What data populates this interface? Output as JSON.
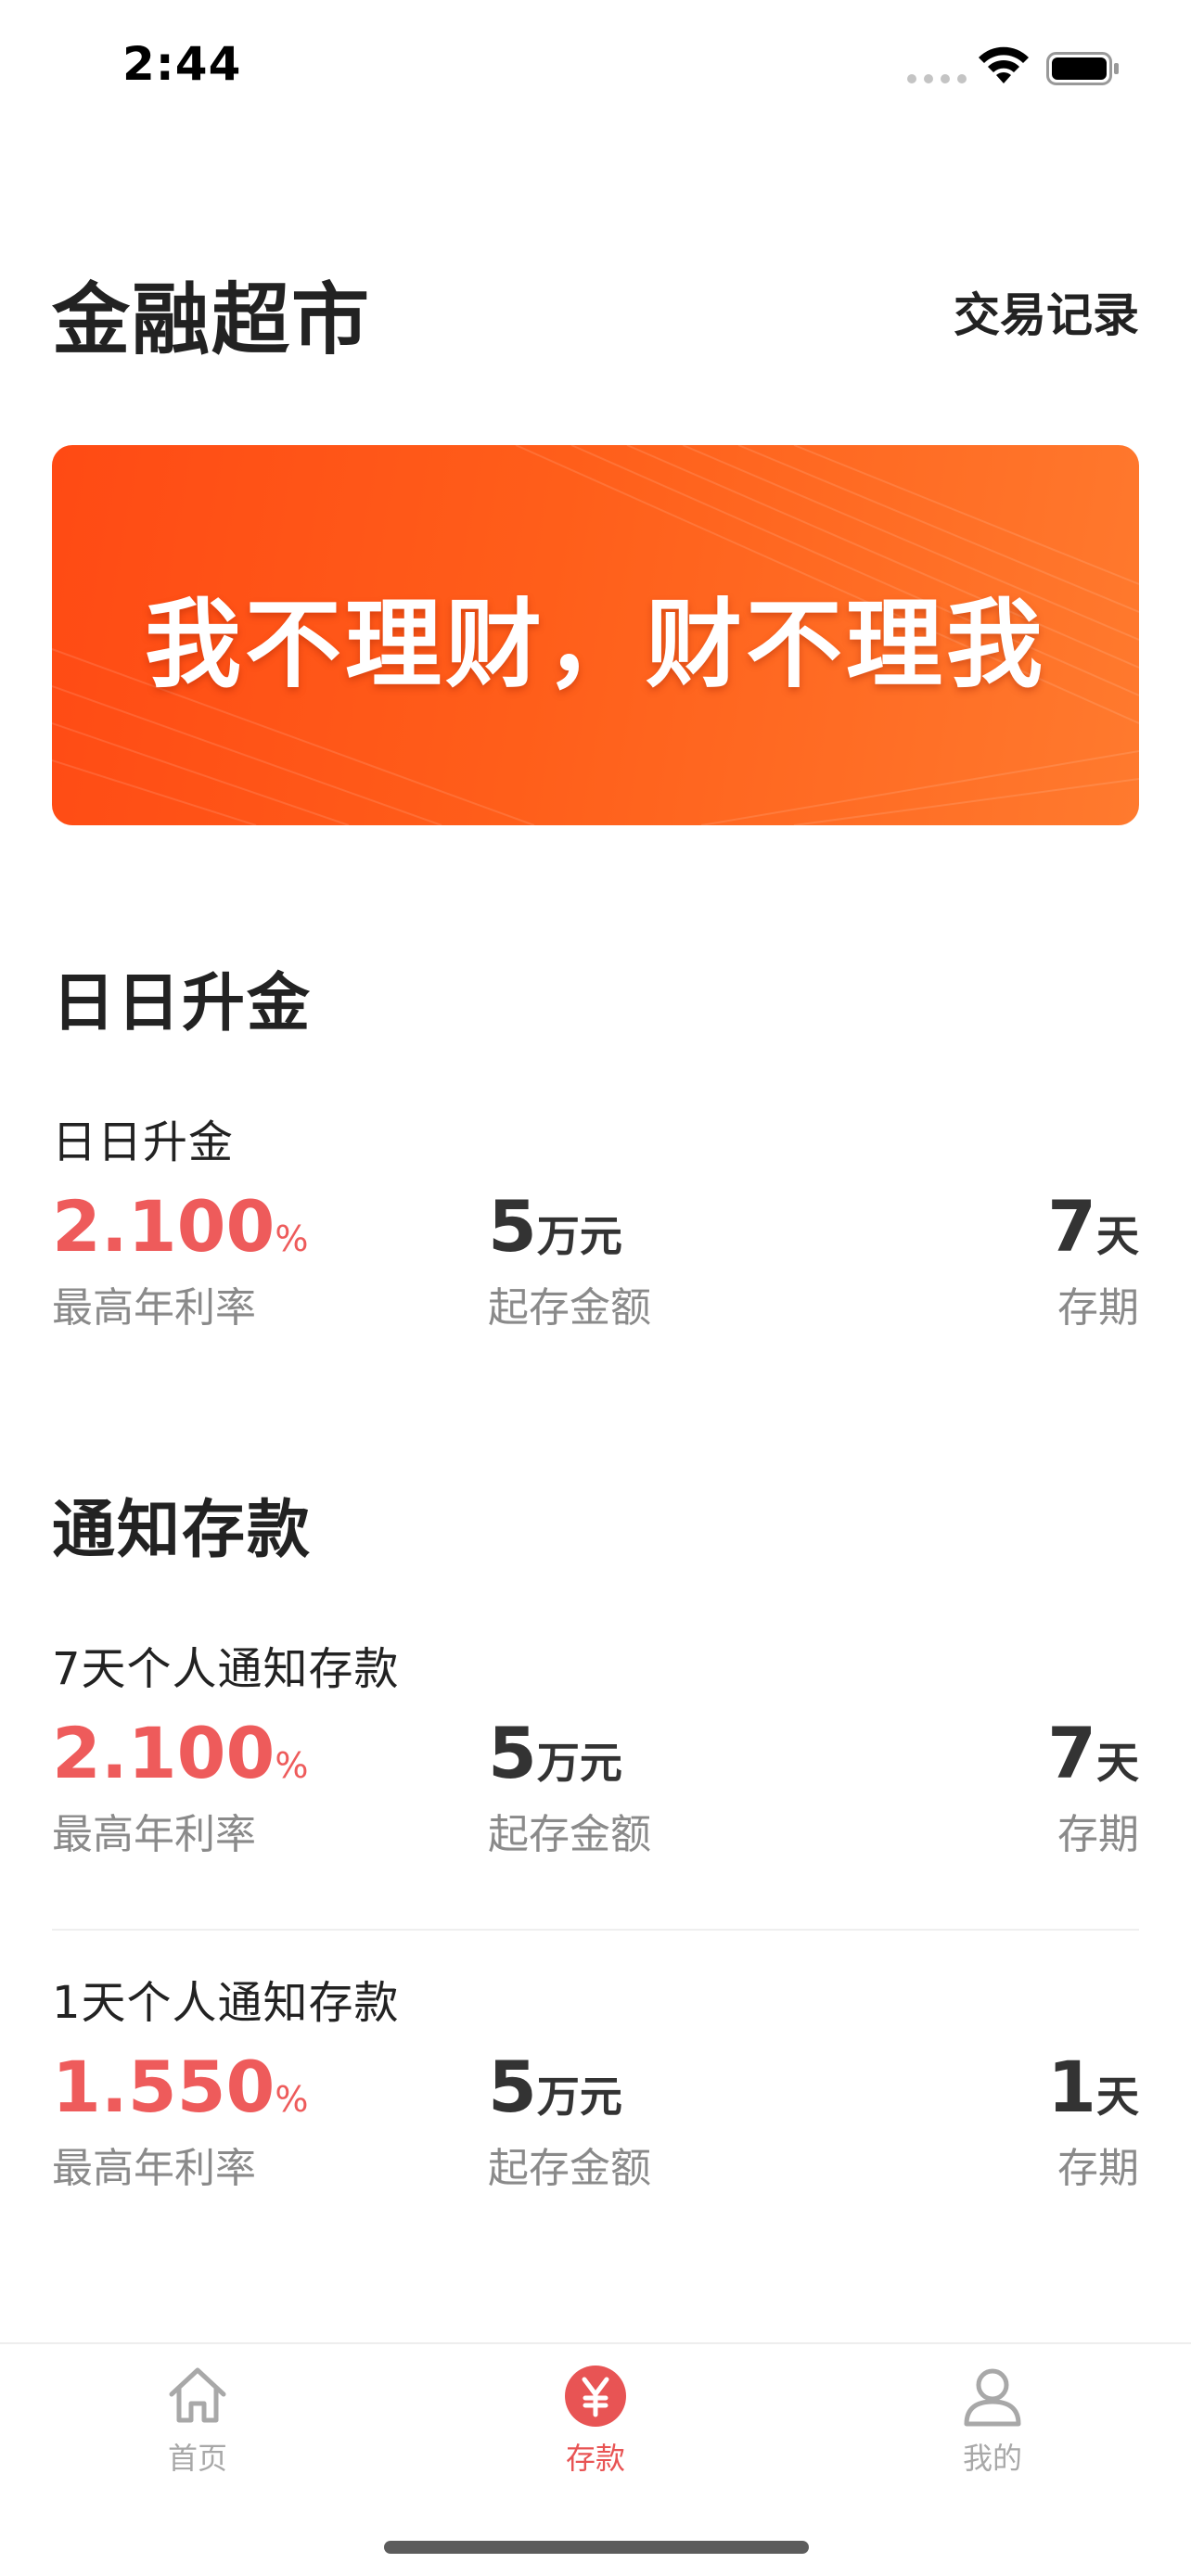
{
  "status_bar": {
    "time": "2:44"
  },
  "header": {
    "title": "金融超市",
    "transaction_link": "交易记录"
  },
  "banner": {
    "text": "我不理财，财不理我"
  },
  "sections": [
    {
      "title": "日日升金",
      "products": [
        {
          "name": "日日升金",
          "rate": "2.100",
          "rate_unit": "%",
          "rate_label": "最高年利率",
          "amount": "5",
          "amount_unit": "万元",
          "amount_label": "起存金额",
          "period": "7",
          "period_unit": "天",
          "period_label": "存期"
        }
      ]
    },
    {
      "title": "通知存款",
      "products": [
        {
          "name": "7天个人通知存款",
          "rate": "2.100",
          "rate_unit": "%",
          "rate_label": "最高年利率",
          "amount": "5",
          "amount_unit": "万元",
          "amount_label": "起存金额",
          "period": "7",
          "period_unit": "天",
          "period_label": "存期"
        },
        {
          "name": "1天个人通知存款",
          "rate": "1.550",
          "rate_unit": "%",
          "rate_label": "最高年利率",
          "amount": "5",
          "amount_unit": "万元",
          "amount_label": "起存金额",
          "period": "1",
          "period_unit": "天",
          "period_label": "存期"
        }
      ]
    }
  ],
  "tab_bar": {
    "items": [
      {
        "label": "首页",
        "icon": "home-icon",
        "active": false
      },
      {
        "label": "存款",
        "icon": "yen-icon",
        "active": true
      },
      {
        "label": "我的",
        "icon": "user-icon",
        "active": false
      }
    ]
  },
  "colors": {
    "accent_red": "#ee5b5b",
    "banner_start": "#ff4a14",
    "banner_end": "#ff7a2e",
    "tab_active": "#e85454",
    "tab_inactive": "#a8a8a8"
  }
}
